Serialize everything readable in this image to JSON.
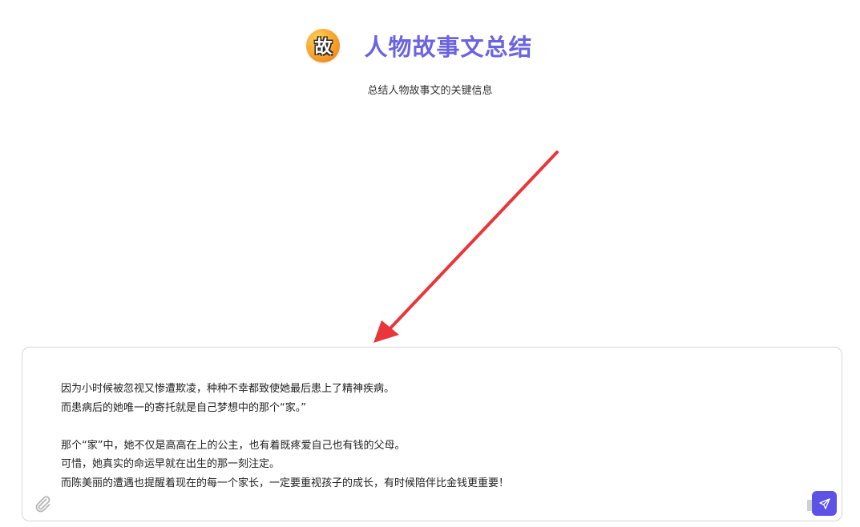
{
  "app": {
    "logo_char": "故",
    "title": "人物故事文总结",
    "subtitle": "总结人物故事文的关键信息"
  },
  "input": {
    "lines": [
      "因为小时候被忽视又惨遭欺凌，种种不幸都致使她最后患上了精神疾病。",
      "而患病后的她唯一的寄托就是自己梦想中的那个“家。”",
      "",
      "那个“家”中，她不仅是高高在上的公主，也有着既疼爱自己也有钱的父母。",
      "可惜，她真实的命运早就在出生的那一刻注定。",
      "而陈美丽的遭遇也提醒着现在的每一个家长，一定要重视孩子的成长，有时候陪伴比金钱更重要！"
    ]
  },
  "icons": {
    "attach": "paperclip-icon",
    "send": "send-icon",
    "annotation": "red-arrow"
  },
  "colors": {
    "accent": "#5c52e6",
    "title": "#6b63e0",
    "arrow": "#e8363b"
  }
}
